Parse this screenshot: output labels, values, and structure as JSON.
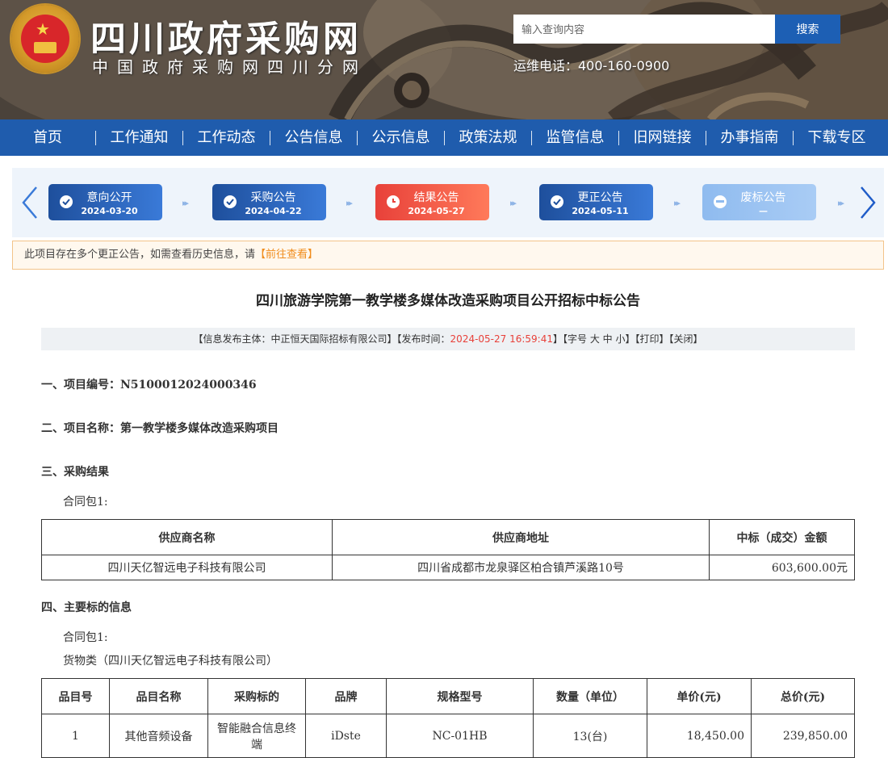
{
  "header": {
    "site_title": "四川政府采购网",
    "site_subtitle": "中国政府采购网四川分网",
    "search_placeholder": "输入查询内容",
    "search_button": "搜索",
    "phone": "运维电话：400-160-0900"
  },
  "nav": [
    "首页",
    "工作通知",
    "工作动态",
    "公告信息",
    "公示信息",
    "政策法规",
    "监管信息",
    "旧网链接",
    "办事指南",
    "下载专区"
  ],
  "steps": [
    {
      "label": "意向公开",
      "date": "2024-03-20",
      "state": "done"
    },
    {
      "label": "采购公告",
      "date": "2024-04-22",
      "state": "done"
    },
    {
      "label": "结果公告",
      "date": "2024-05-27",
      "state": "current"
    },
    {
      "label": "更正公告",
      "date": "2024-05-11",
      "state": "done"
    },
    {
      "label": "废标公告",
      "date": "—",
      "state": "inactive"
    }
  ],
  "notice": {
    "text": "此项目存在多个更正公告，如需查看历史信息，请",
    "link": "【前往查看】"
  },
  "article": {
    "title": "四川旅游学院第一教学楼多媒体改造采购项目公开招标中标公告",
    "meta_publisher": "【信息发布主体：中正恒天国际招标有限公司】【发布时间：",
    "meta_time": "2024-05-27 16:59:41",
    "meta_rest": "】【字号 大 中 小】【打印】【关闭】",
    "section1": "一、项目编号：N5100012024000346",
    "section2": "二、项目名称：第一教学楼多媒体改造采购项目",
    "section3": "三、采购结果",
    "package1": "合同包1:",
    "section4": "四、主要标的信息",
    "package2": "合同包1:",
    "goods_line": "货物类（四川天亿智远电子科技有限公司）"
  },
  "result_table": {
    "headers": [
      "供应商名称",
      "供应商地址",
      "中标（成交）金额"
    ],
    "rows": [
      [
        "四川天亿智远电子科技有限公司",
        "四川省成都市龙泉驿区柏合镇芦溪路10号",
        "603,600.00元"
      ]
    ]
  },
  "items_table": {
    "headers": [
      "品目号",
      "品目名称",
      "采购标的",
      "品牌",
      "规格型号",
      "数量（单位）",
      "单价(元)",
      "总价(元)"
    ],
    "rows": [
      [
        "1",
        "其他音频设备",
        "智能融合信息终端",
        "iDste",
        "NC-01HB",
        "13(台)",
        "18,450.00",
        "239,850.00"
      ]
    ]
  },
  "colors": {
    "nav_blue": "#1f5cad",
    "step_blue": "#1e4f9c",
    "step_red": "#e8413a",
    "time_red": "#e8413a",
    "notice_orange": "#f08c1c"
  }
}
